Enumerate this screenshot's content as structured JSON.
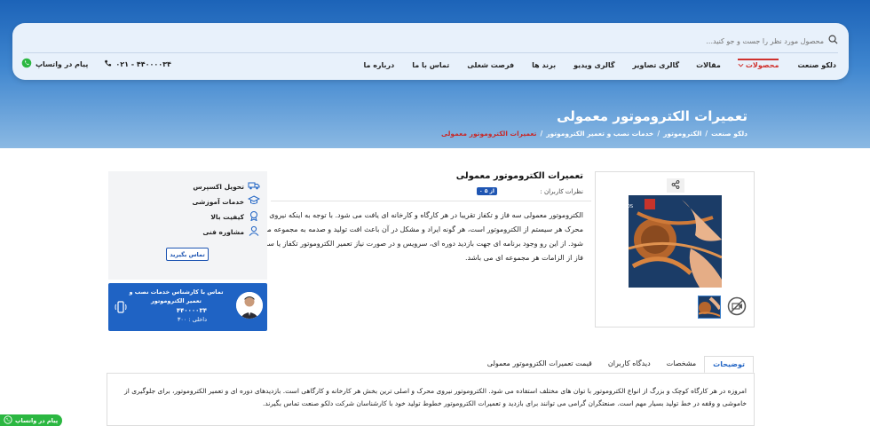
{
  "search": {
    "placeholder": "محصول مورد نظر را جست و جو کنید..."
  },
  "nav": {
    "items": [
      {
        "label": "دلکو صنعت",
        "active": false
      },
      {
        "label": "محصولات",
        "active": true
      },
      {
        "label": "مقالات",
        "active": false
      },
      {
        "label": "گالری تصاویر",
        "active": false
      },
      {
        "label": "گالری ویدیو",
        "active": false
      },
      {
        "label": "برند ها",
        "active": false
      },
      {
        "label": "فرصت شغلی",
        "active": false
      },
      {
        "label": "تماس با ما",
        "active": false
      },
      {
        "label": "درباره ما",
        "active": false
      }
    ]
  },
  "header_contact": {
    "whatsapp_label": "پیام در واتساپ",
    "phone": "۰۲۱ - ۴۴۰۰۰۰۳۴"
  },
  "page": {
    "title": "تعمیرات الکتروموتور معمولی",
    "breadcrumb": [
      "دلکو صنعت",
      "الکتروموتور",
      "خدمات نصب و تعمیر الکتروموتور",
      "تعمیرات الکتروموتور معمولی"
    ]
  },
  "product": {
    "title": "تعمیرات الکتروموتور معمولی",
    "rating_label": "نظرات کاربران :",
    "rating_value": "۰ از ۵",
    "description": "الکتروموتور معمولی سه فاز و تکفاز تقریبا در هر کارگاه و کارخانه ای یافت می شود. با توجه به اینکه نیروی محرک هر سیستم از الکتروموتور است، هر گونه ایراد و مشکل در آن باعث افت تولید و صدمه به مجموعه می شود. از این رو وجود برنامه ای جهت بازدید دوره ای، سرویس و در صورت نیاز تعمیر الکتروموتور تکفاز یا سه فاز از الزامات هر مجموعه ای می باشد."
  },
  "features": [
    {
      "icon": "truck-icon",
      "label": "تحویل اکسپرس"
    },
    {
      "icon": "education-icon",
      "label": "خدمات آموزشی"
    },
    {
      "icon": "quality-badge-icon",
      "label": "کیفیت بالا"
    },
    {
      "icon": "consultant-icon",
      "label": "مشاوره فنی"
    }
  ],
  "contact_button": "تماس بگیرید",
  "expert": {
    "title": "تماس با کارشناس خدمات نصب و تعمیر الکتروموتور",
    "phone": "۴۴۰۰۰۰۳۴",
    "ext": "داخلی : ۳۰۰"
  },
  "tabs": [
    {
      "label": "توضیحات",
      "active": true
    },
    {
      "label": "مشخصات",
      "active": false
    },
    {
      "label": "دیدگاه کاربران",
      "active": false
    },
    {
      "label": "قیمت تعمیرات الکتروموتور معمولی",
      "active": false
    }
  ],
  "tab_content": "امروزه در هر کارگاه کوچک و بزرگ از انواع الکتروموتور با توان های مختلف استفاده می شود. الکتروموتور نیروی محرک و اصلی ترین بخش هر کارخانه و کارگاهی است. بازدیدهای دوره ای و تعمیر الکتروموتور، برای جلوگیری از خاموشی و وقفه در خط تولید بسیار مهم است. صنعتگران گرامی می توانند برای بازدید و تعمیرات الکتروموتور خطوط تولید خود با کارشناسان شرکت دلکو صنعت تماس بگیرند.",
  "whatsapp_float": "پیام در واتساپ",
  "colors": {
    "primary": "#1f63c4",
    "accent": "#d0312d",
    "whatsapp": "#2bb741"
  }
}
